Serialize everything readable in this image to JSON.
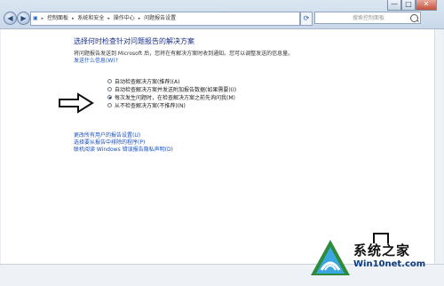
{
  "window": {
    "controls": [
      "—",
      "□",
      "✕"
    ]
  },
  "address_bar": {
    "segments": [
      "控制面板",
      "系统和安全",
      "操作中心",
      "问题报告设置"
    ]
  },
  "search": {
    "placeholder": "搜索控制面板"
  },
  "main": {
    "title": "选择何时检查针对问题报告的解决方案",
    "description": "将问题报告发送到 Microsoft 后，您将在有解决方案时收到通知。您可以调整发送的信息量。",
    "desc_link": "发送什么信息(W)?",
    "options": [
      {
        "label": "自动检查解决方案(推荐)(A)",
        "selected": false
      },
      {
        "label": "自动检查解决方案并发送附加报告数据(如果需要)(I)",
        "selected": false
      },
      {
        "label": "每次发生问题时，在检查解决方案之前先询问我(M)",
        "selected": true
      },
      {
        "label": "从不检查解决方案(不推荐)(N)",
        "selected": false
      }
    ],
    "links": [
      "更改所有用户的报告设置(U)",
      "选择要从报告中排除的程序(P)",
      "联机阅读 Windows 错误报告隐私声明(D)"
    ]
  },
  "watermark": {
    "text": "系统之家",
    "url": "Win10net.com"
  },
  "colors": {
    "title": "#1e3287",
    "link": "#1a4fb8"
  }
}
